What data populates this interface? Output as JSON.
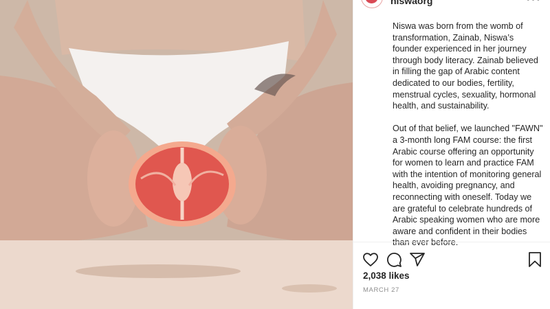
{
  "post": {
    "username": "niswaorg",
    "more_icon": "•••",
    "caption": [
      "Niswa was born from the womb of transformation, Zainab, Niswa’s founder experienced in her journey through body literacy. Zainab believed in filling the gap of Arabic content dedicated to our bodies, fertility, menstrual cycles, sexuality, hormonal health, and sustainability.",
      "Out of that belief, we launched \"FAWN\" a 3-month long FAM course: the first Arabic course offering an opportunity for women to learn and practice FAM with the intention of monitoring general health, avoiding pregnancy, and reconnecting with oneself. Today we are grateful to celebrate hundreds of Arabic speaking women who are more aware and confident in their bodies than ever before."
    ],
    "likes": "2,038 likes",
    "date": "MARCH 27"
  },
  "icons": {
    "like": "heart-icon",
    "comment": "comment-icon",
    "share": "share-icon",
    "save": "bookmark-icon"
  },
  "colors": {
    "text": "#262626",
    "muted": "#8e8e8e",
    "grapefruit": "#e0574f"
  }
}
